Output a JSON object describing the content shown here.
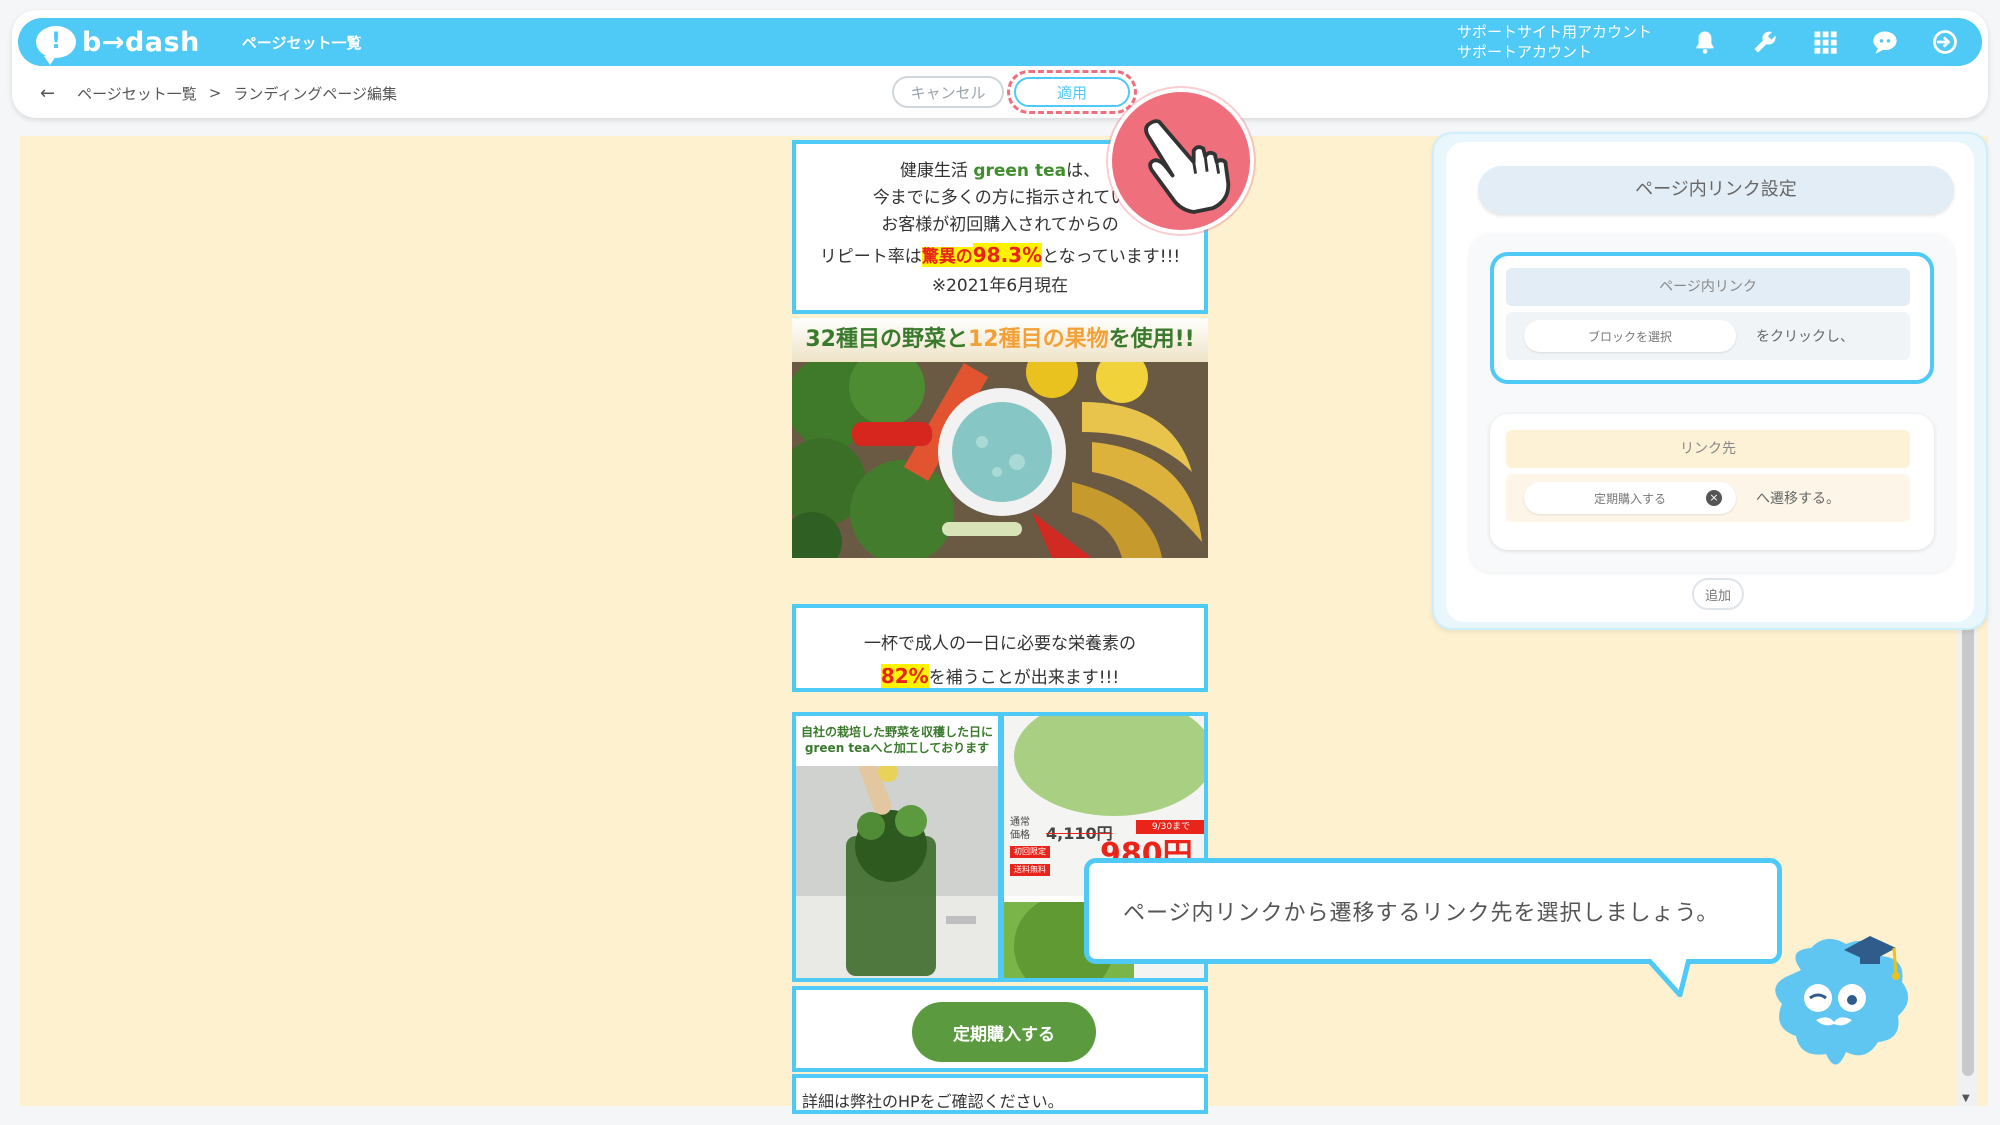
{
  "header": {
    "logo_mark": "!",
    "logo_text": "b→dash",
    "nav_title": "ページセット一覧",
    "account_line1": "サポートサイト用アカウント",
    "account_line2": "サポートアカウント",
    "icons": [
      "bell-icon",
      "wrench-icon",
      "grid-icon",
      "chat-icon",
      "logout-icon"
    ],
    "accent_color": "#4fc9f5"
  },
  "subbar": {
    "back": "←",
    "crumb1": "ページセット一覧",
    "sep": ">",
    "crumb2": "ランディングページ編集",
    "cancel_label": "キャンセル",
    "apply_label": "適用"
  },
  "lp": {
    "block1": {
      "line1_pre": "健康生活 ",
      "line1_green": "green tea",
      "line1_post": "は、",
      "line2": "今までに多くの方に指示されてい",
      "line3": "お客様が初回購入されてからの",
      "line4_pre": "リピート率は",
      "line4_hl1": "驚異の",
      "line4_hl2": "98.3%",
      "line4_post": "となっています!!!",
      "line5": "※2021年6月現在"
    },
    "photo1": {
      "title_a": "32種目の野菜",
      "title_b": "と",
      "title_c": "12種目の果物",
      "title_d": "を使用!!"
    },
    "block3": {
      "line1": "一杯で成人の一日に必要な栄養素の",
      "hl": "82%",
      "line2_post": "を補うことが出来ます!!!"
    },
    "tile_left_caption1": "自社の栽培した野菜を収穫した日に",
    "tile_left_caption2": "green teaへと加工しております",
    "tile_right": {
      "label1": "通常",
      "label2": "価格",
      "old_price": "4,110円",
      "tag": "9/30まで",
      "tag2": "初回限定",
      "tag3": "送料無料",
      "new_price": "980円"
    },
    "buy_button": "定期購入する",
    "footer_text": "詳細は弊社のHPをご確認ください。"
  },
  "panel": {
    "title": "ページ内リンク設定",
    "link_head": "ページ内リンク",
    "link_pill": "ブロックを選択",
    "link_suffix": "をクリックし、",
    "dest_head": "リンク先",
    "dest_pill": "定期購入する",
    "dest_clear": "×",
    "dest_suffix": "へ遷移する。",
    "add_label": "追加"
  },
  "tooltip": {
    "text": "ページ内リンクから遷移するリンク先を選択しましょう。"
  },
  "scroll": {
    "down": "▼"
  }
}
